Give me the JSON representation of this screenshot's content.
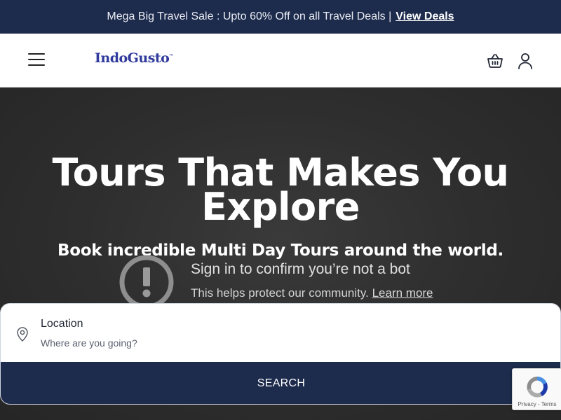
{
  "promo": {
    "text": "Mega Big Travel Sale : Upto 60% Off on all Travel Deals |",
    "link_label": "View Deals"
  },
  "header": {
    "logo_text": "IndoGusto",
    "logo_mark": "™",
    "icons": [
      "menu-icon",
      "basket-icon",
      "user-icon"
    ]
  },
  "hero": {
    "title": "Tours That Makes You Explore",
    "subtitle": "Book incredible Multi Day Tours around the world."
  },
  "bot_check": {
    "title": "Sign in to confirm you’re not a bot",
    "description": "This helps protect our community.",
    "link_label": "Learn more",
    "icon": "alert-circle-icon"
  },
  "search": {
    "location_label": "Location",
    "location_placeholder": "Where are you going?",
    "location_icon": "map-pin-icon",
    "button_label": "SEARCH"
  },
  "recaptcha": {
    "links": "Privacy - Terms"
  },
  "colors": {
    "navy": "#1d2b4c",
    "logo_blue": "#2f3a9c",
    "hero_bg": "#2e2e2e"
  }
}
